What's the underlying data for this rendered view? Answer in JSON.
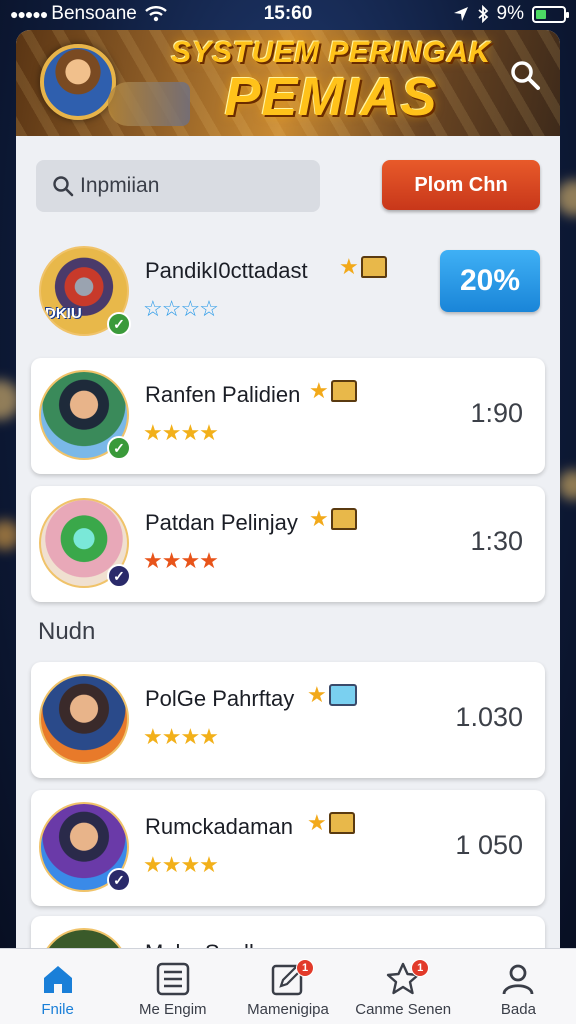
{
  "status_bar": {
    "carrier": "Bensoane",
    "time": "15:60",
    "battery": "9%"
  },
  "banner": {
    "title_line1": "SYSTUEM PERINGAK",
    "title_line2": "PEMIAS",
    "search_icon": "search-icon"
  },
  "controls": {
    "search_text": "Inpmiian",
    "primary_button": "Plom Chn"
  },
  "featured": {
    "name": "PandikI0cttadast",
    "avatar_label": "DKIU",
    "percent": "20%",
    "stars": "☆☆☆☆"
  },
  "rows": [
    {
      "name": "Ranfen Palidien",
      "value": "1:90",
      "stars": "★★★★"
    },
    {
      "name": "Patdan Pelinjay",
      "value": "1:30",
      "stars": "★★★★"
    }
  ],
  "section_label": "Nudn",
  "rows2": [
    {
      "name": "PolGe Pahrftay",
      "value": "1.030",
      "stars": "★★★★"
    },
    {
      "name": "Rumckadaman",
      "value": "1 050",
      "stars": "★★★★"
    },
    {
      "name": "Mako Sooll",
      "value": "",
      "stars": ""
    }
  ],
  "colors": {
    "accent_blue": "#1a85d8",
    "accent_orange": "#d8441f",
    "gold": "#ffc21a"
  },
  "nav": [
    {
      "label": "Fnile",
      "icon": "home-icon",
      "active": true
    },
    {
      "label": "Me Engim",
      "icon": "list-icon"
    },
    {
      "label": "Mamenigipa",
      "icon": "edit-icon",
      "badge": "1"
    },
    {
      "label": "Canme Senen",
      "icon": "star-icon",
      "badge": "1"
    },
    {
      "label": "Bada",
      "icon": "user-icon"
    }
  ]
}
